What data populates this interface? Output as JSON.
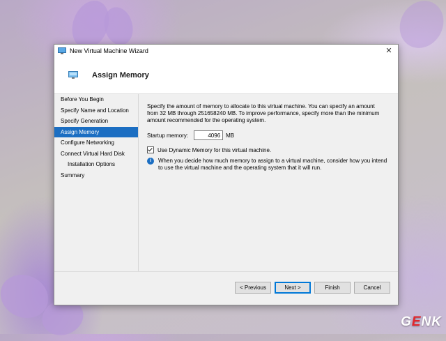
{
  "window": {
    "title": "New Virtual Machine Wizard",
    "close_glyph": "✕"
  },
  "header": {
    "title": "Assign Memory",
    "icon": "memory-chip-icon"
  },
  "nav": {
    "items": [
      {
        "label": "Before You Begin",
        "active": false,
        "sub": false
      },
      {
        "label": "Specify Name and Location",
        "active": false,
        "sub": false
      },
      {
        "label": "Specify Generation",
        "active": false,
        "sub": false
      },
      {
        "label": "Assign Memory",
        "active": true,
        "sub": false
      },
      {
        "label": "Configure Networking",
        "active": false,
        "sub": false
      },
      {
        "label": "Connect Virtual Hard Disk",
        "active": false,
        "sub": false
      },
      {
        "label": "Installation Options",
        "active": false,
        "sub": true
      },
      {
        "label": "Summary",
        "active": false,
        "sub": false
      }
    ]
  },
  "content": {
    "description": "Specify the amount of memory to allocate to this virtual machine. You can specify an amount from 32 MB through 251658240 MB. To improve performance, specify more than the minimum amount recommended for the operating system.",
    "startup_label": "Startup memory:",
    "startup_value": "4096",
    "startup_unit": "MB",
    "dynamic_label": "Use Dynamic Memory for this virtual machine.",
    "dynamic_checked": true,
    "info_glyph": "i",
    "info_text": "When you decide how much memory to assign to a virtual machine, consider how you intend to use the virtual machine and the operating system that it will run."
  },
  "footer": {
    "previous": "< Previous",
    "next": "Next >",
    "finish": "Finish",
    "cancel": "Cancel"
  },
  "watermark": {
    "g": "G",
    "e": "E",
    "nk": "NK"
  },
  "colors": {
    "accent": "#1b6ec2",
    "default_button_border": "#0078d7"
  }
}
